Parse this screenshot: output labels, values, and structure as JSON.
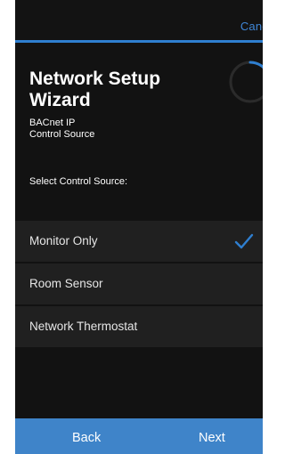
{
  "header": {
    "cancel_label": "Canc"
  },
  "wizard": {
    "title": "Network Setup Wizard",
    "subtitle_line1": "BACnet IP",
    "subtitle_line2": "Control Source",
    "select_label": "Select Control Source:"
  },
  "options": [
    {
      "label": "Monitor Only",
      "selected": true
    },
    {
      "label": "Room Sensor",
      "selected": false
    },
    {
      "label": "Network Thermostat",
      "selected": false
    }
  ],
  "footer": {
    "back_label": "Back",
    "next_label": "Next"
  },
  "colors": {
    "accent": "#2f7fd0",
    "background": "#121212",
    "option_bg": "#202020",
    "footer_bg": "#3f84c9"
  },
  "icons": {
    "progress": "progress-ring-icon",
    "selected": "checkmark-icon"
  }
}
